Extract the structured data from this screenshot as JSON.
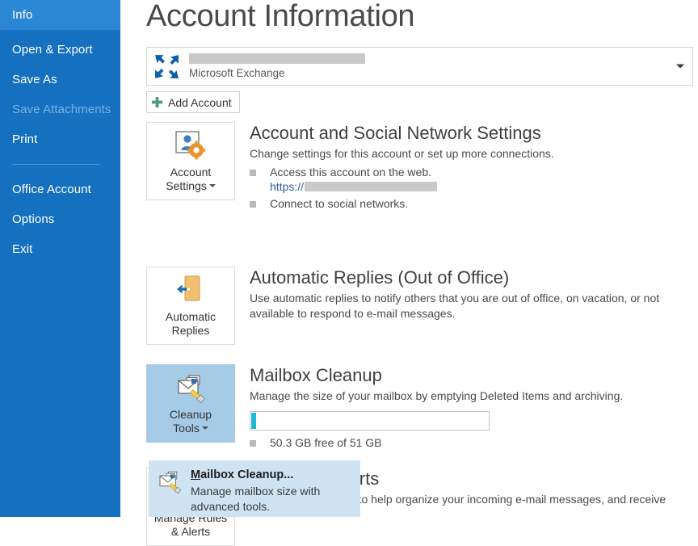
{
  "sidebar": {
    "items": [
      {
        "label": "Info",
        "state": "selected"
      },
      {
        "label": "Open & Export",
        "state": "normal"
      },
      {
        "label": "Save As",
        "state": "normal"
      },
      {
        "label": "Save Attachments",
        "state": "disabled"
      },
      {
        "label": "Print",
        "state": "normal"
      },
      {
        "label": "Office Account",
        "state": "normal"
      },
      {
        "label": "Options",
        "state": "normal"
      },
      {
        "label": "Exit",
        "state": "normal"
      }
    ],
    "background_color": "#1570bf",
    "selected_color": "#2b87d4",
    "disabled_color": "#79b2e0"
  },
  "page": {
    "title": "Account Information"
  },
  "account_selector": {
    "account_name": "",
    "account_type": "Microsoft Exchange",
    "chevron": "chevron-down-icon",
    "add_account_label": "Add Account"
  },
  "sections": {
    "account_settings": {
      "button_label_line1": "Account",
      "button_label_line2": "Settings",
      "has_caret": true,
      "heading": "Account and Social Network Settings",
      "description": "Change settings for this account or set up more connections.",
      "bullets": [
        "Access this account on the web.",
        "Connect to social networks."
      ],
      "link_prefix": "https://"
    },
    "automatic_replies": {
      "button_label_line1": "Automatic",
      "button_label_line2": "Replies",
      "has_caret": false,
      "heading": "Automatic Replies (Out of Office)",
      "description": "Use automatic replies to notify others that you are out of office, on vacation, or not available to respond to e-mail messages."
    },
    "mailbox_cleanup": {
      "button_label_line1": "Cleanup",
      "button_label_line2": "Tools",
      "has_caret": true,
      "active": true,
      "heading": "Mailbox Cleanup",
      "description": "Manage the size of your mailbox by emptying Deleted Items and archiving.",
      "quota_caption": "50.3 GB free of 51 GB",
      "quota_fill_percent": 2,
      "quota_fill_color": "#21b8d8"
    },
    "rules_and_alerts": {
      "heading": "Rules and Alerts",
      "description": "Use Rules and Alerts to help organize your incoming e-mail messages, and receive"
    }
  },
  "cleanup_menu": {
    "item_title_accelerator": "M",
    "item_title_rest": "ailbox Cleanup...",
    "item_description": "Manage mailbox size with advanced tools.",
    "background_color": "#cfe3f2"
  }
}
